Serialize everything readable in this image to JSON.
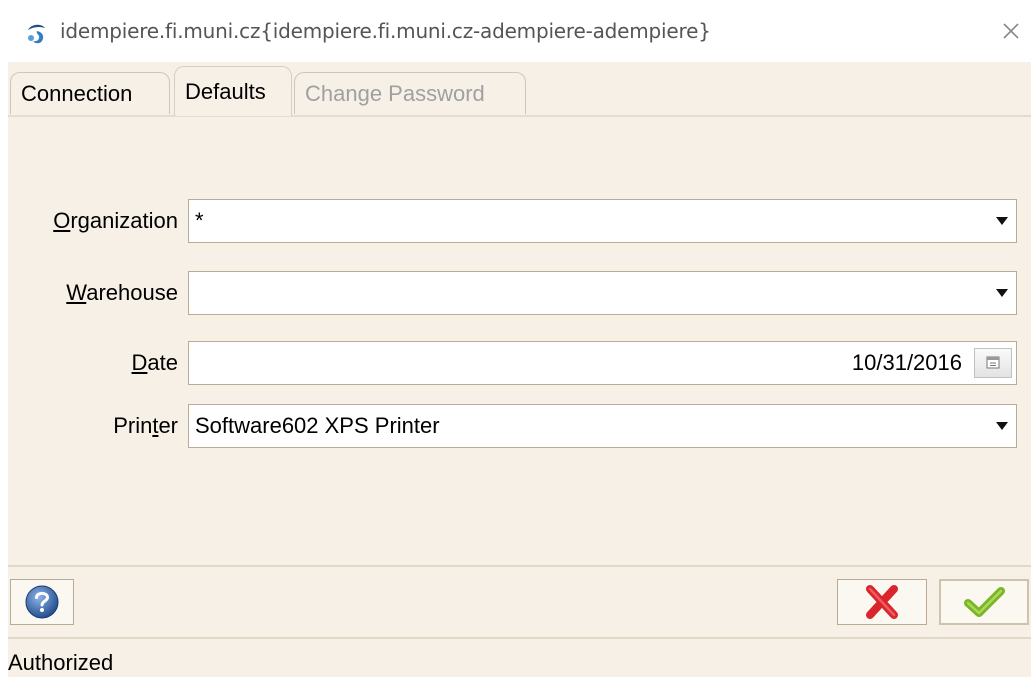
{
  "window": {
    "title": "idempiere.fi.muni.cz{idempiere.fi.muni.cz-adempiere-adempiere}",
    "icon": "idempiere-logo-icon",
    "close_icon": "close-icon"
  },
  "tabs": [
    {
      "label": "Connection",
      "state": "normal"
    },
    {
      "label": "Defaults",
      "state": "selected"
    },
    {
      "label": "Change Password",
      "state": "disabled"
    }
  ],
  "form": {
    "organization": {
      "label_ul": "O",
      "label_rest": "rganization",
      "value": "*"
    },
    "warehouse": {
      "label_ul": "W",
      "label_rest": "arehouse",
      "value": ""
    },
    "date": {
      "label_ul": "D",
      "label_rest": "ate",
      "value": "10/31/2016"
    },
    "printer": {
      "label_pre": "Prin",
      "label_ul": "t",
      "label_rest": "er",
      "value": "Software602 XPS Printer"
    }
  },
  "buttons": {
    "help_icon": "help-icon",
    "cancel_icon": "cancel-x-icon",
    "ok_icon": "ok-check-icon"
  },
  "status": {
    "text": "Authorized"
  },
  "colors": {
    "background": "#f7f0e6",
    "border": "#b9ab95",
    "cancel": "#d9262c",
    "ok": "#7ab626"
  }
}
